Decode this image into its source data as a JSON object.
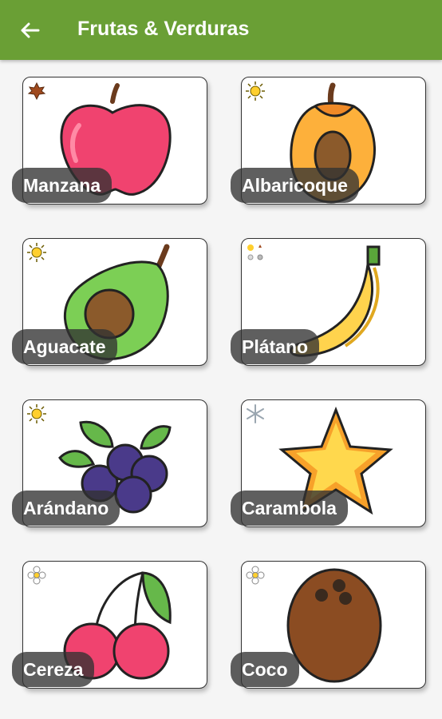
{
  "appbar": {
    "title": "Frutas & Verduras",
    "back_icon": "arrow-left-icon",
    "color": "#6a9f35"
  },
  "fruits": [
    {
      "label": "Manzana",
      "season_icon": "autumn-leaf-icon"
    },
    {
      "label": "Albaricoque",
      "season_icon": "sun-icon"
    },
    {
      "label": "Aguacate",
      "season_icon": "sun-icon"
    },
    {
      "label": "Plátano",
      "season_icon": "all-seasons-icon"
    },
    {
      "label": "Arándano",
      "season_icon": "sun-icon"
    },
    {
      "label": "Carambola",
      "season_icon": "snowflake-icon"
    },
    {
      "label": "Cereza",
      "season_icon": "flower-icon"
    },
    {
      "label": "Coco",
      "season_icon": "flower-icon"
    }
  ]
}
